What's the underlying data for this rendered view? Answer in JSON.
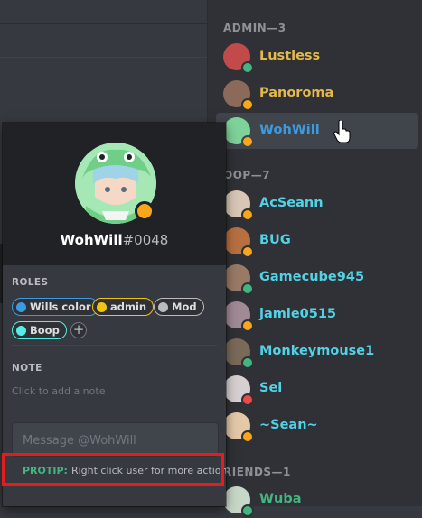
{
  "member_list": {
    "groups": [
      {
        "header": "ADMIN—3",
        "members": [
          {
            "name": "Lustless",
            "color": "#e4b84a",
            "status": "online",
            "status_color": "#43b581",
            "hover": false
          },
          {
            "name": "Panoroma",
            "color": "#e4b84a",
            "status": "idle",
            "status_color": "#faa61a",
            "hover": false
          },
          {
            "name": "WohWill",
            "color": "#3c9be0",
            "status": "idle",
            "status_color": "#faa61a",
            "hover": true
          }
        ]
      },
      {
        "header": "OOP—7",
        "members": [
          {
            "name": "AcSeann",
            "color": "#51d2e5",
            "status": "idle",
            "status_color": "#faa61a",
            "hover": false
          },
          {
            "name": "BUG",
            "color": "#51d2e5",
            "status": "idle",
            "status_color": "#faa61a",
            "hover": false
          },
          {
            "name": "Gamecube945",
            "color": "#51d2e5",
            "status": "online",
            "status_color": "#43b581",
            "hover": false
          },
          {
            "name": "jamie0515",
            "color": "#51d2e5",
            "status": "idle",
            "status_color": "#faa61a",
            "hover": false
          },
          {
            "name": "Monkeymouse1",
            "color": "#51d2e5",
            "status": "online",
            "status_color": "#43b581",
            "hover": false
          },
          {
            "name": "Sei",
            "color": "#51d2e5",
            "status": "dnd",
            "status_color": "#f04747",
            "hover": false
          },
          {
            "name": "~Sean~",
            "color": "#51d2e5",
            "status": "idle",
            "status_color": "#faa61a",
            "hover": false
          }
        ]
      },
      {
        "header": "RIENDS—1",
        "members": [
          {
            "name": "Wuba",
            "color": "#43b581",
            "status": "online",
            "status_color": "#43b581",
            "hover": false
          }
        ]
      }
    ]
  },
  "profile": {
    "username": "WohWill",
    "discriminator": "#0048",
    "status": "idle",
    "status_color": "#faa61a",
    "roles_label": "ROLES",
    "roles": [
      {
        "name": "Wills color",
        "color": "#3c9be0"
      },
      {
        "name": "admin",
        "color": "#f1c40f"
      },
      {
        "name": "Mod",
        "color": "#b9bbbe"
      },
      {
        "name": "Boop",
        "color": "#51f0e5"
      }
    ],
    "add_role_symbol": "+",
    "note_label": "NOTE",
    "note_placeholder": "Click to add a note",
    "message_placeholder": "Message @WohWill",
    "protip_label": "PROTIP:",
    "protip_text": "Right click user for more actions"
  },
  "colors": {
    "background": "#36393f",
    "member_list_bg": "#2f3136",
    "popout_header_bg": "#202225",
    "highlight_border": "#e21d1d"
  }
}
